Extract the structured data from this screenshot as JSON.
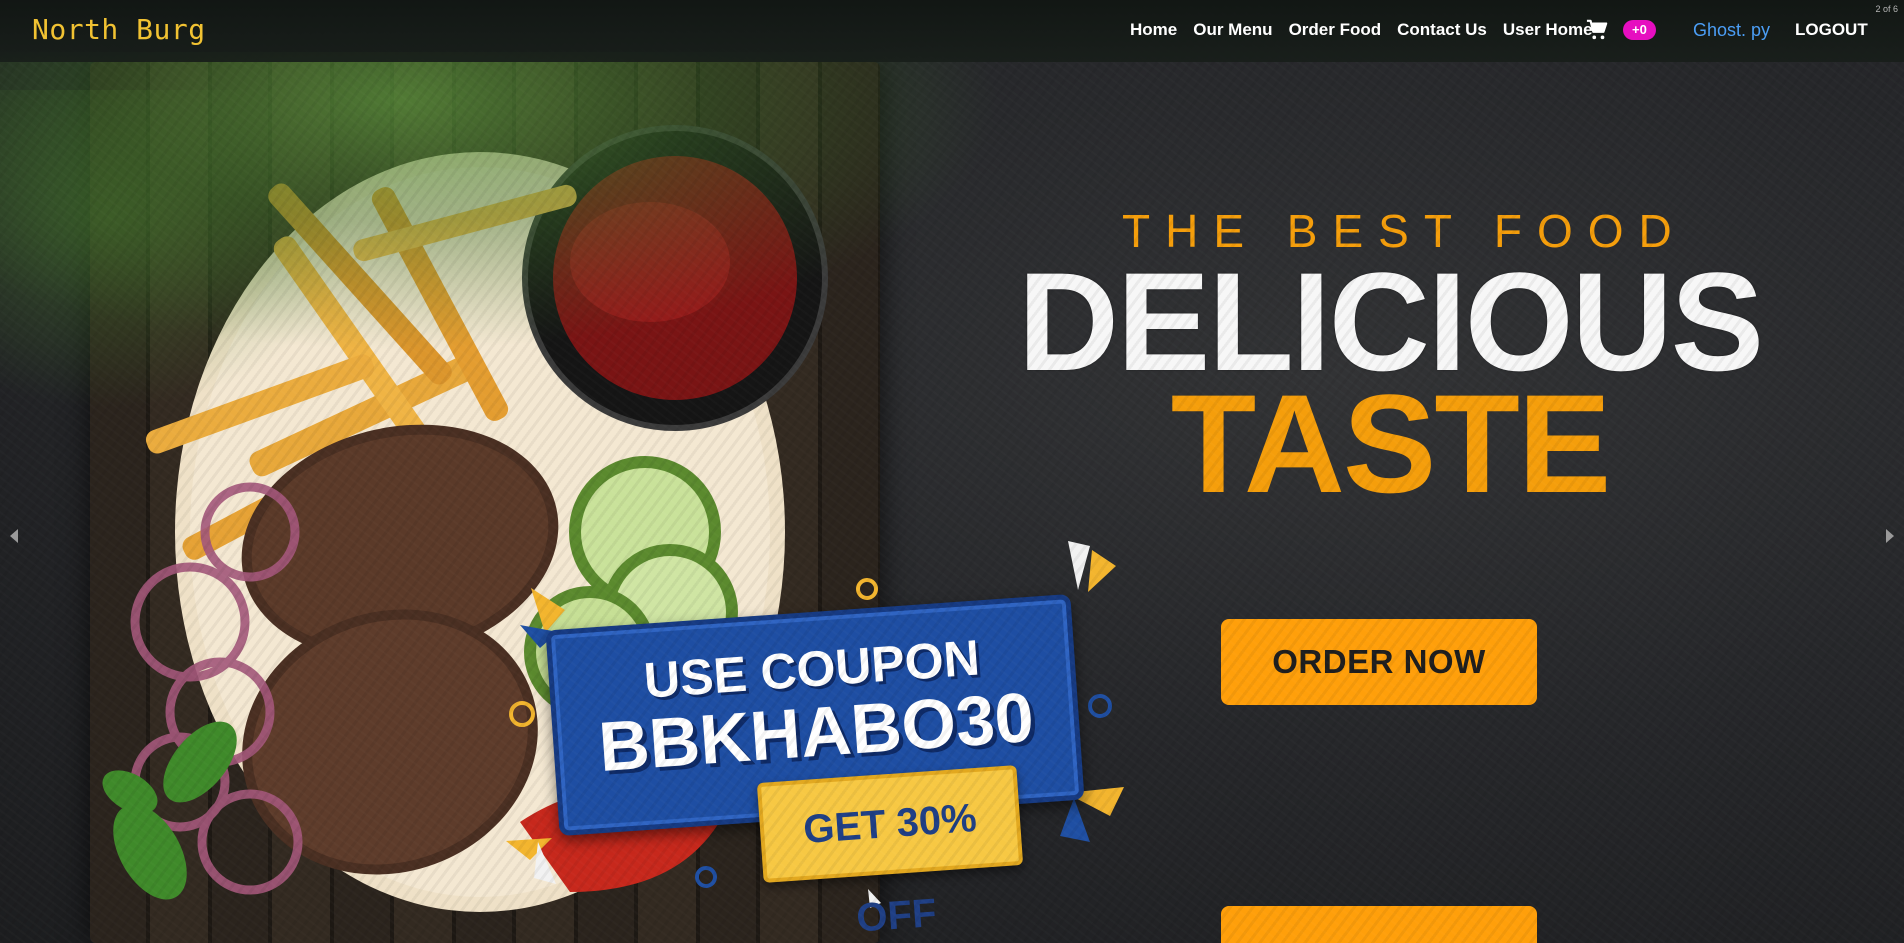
{
  "navbar": {
    "brand": "North Burg",
    "links": [
      "Home",
      "Our Menu",
      "Order Food",
      "Contact Us",
      "User Home"
    ],
    "cart_icon": "cart-icon",
    "cart_count": "+0",
    "user_name": "Ghost. py",
    "logout_label": "LOGOUT"
  },
  "slider": {
    "counter": "2 of 6",
    "prev_icon": "chevron-left-icon",
    "next_icon": "chevron-right-icon"
  },
  "hero": {
    "eyebrow": "THE BEST FOOD",
    "headline_line1": "DELICIOUS",
    "headline_line2": "TASTE",
    "order_button": "ORDER NOW"
  },
  "promo": {
    "line1": "USE COUPON",
    "code": "BBKHABO30",
    "offer": "GET 30% OFF"
  },
  "colors": {
    "accent": "#ff9f0a",
    "brand": "#f1c232",
    "badge": "#e60ec0",
    "user": "#4b9ef5",
    "coupon_blue": "#1e4ea3"
  }
}
